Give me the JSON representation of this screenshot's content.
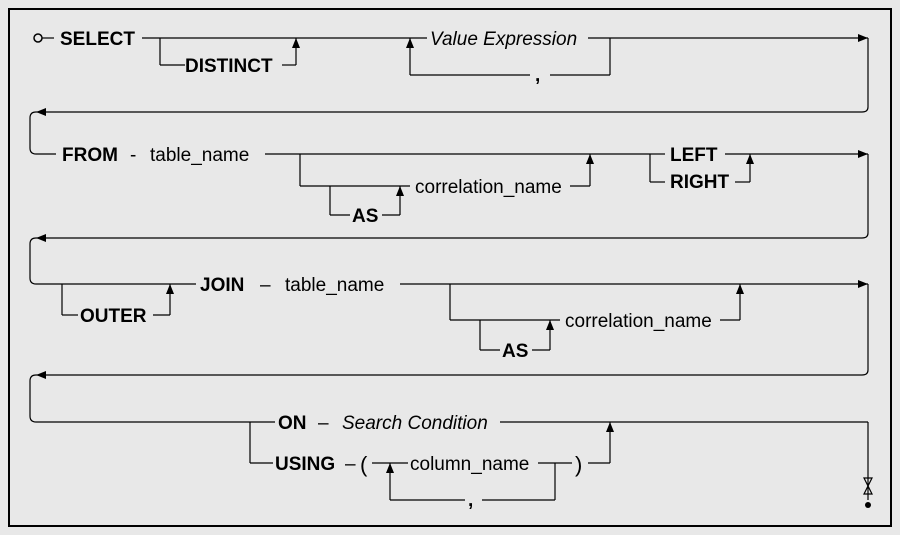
{
  "keywords": {
    "select": "SELECT",
    "distinct": "DISTINCT",
    "from": "FROM",
    "as1": "AS",
    "left": "LEFT",
    "right": "RIGHT",
    "outer": "OUTER",
    "join": "JOIN",
    "as2": "AS",
    "on": "ON",
    "using": "USING"
  },
  "tokens": {
    "value_expression": "Value Expression",
    "table_name1": "table_name",
    "correlation_name1": "correlation_name",
    "table_name2": "table_name",
    "correlation_name2": "correlation_name",
    "search_condition": "Search Condition",
    "column_name": "column_name"
  },
  "punct": {
    "lparen": "(",
    "rparen": ")",
    "comma1": ",",
    "comma2": ",",
    "dash1": "-",
    "dash2": "–",
    "dash3": "–",
    "dash4": "–",
    "dash5": "–"
  }
}
